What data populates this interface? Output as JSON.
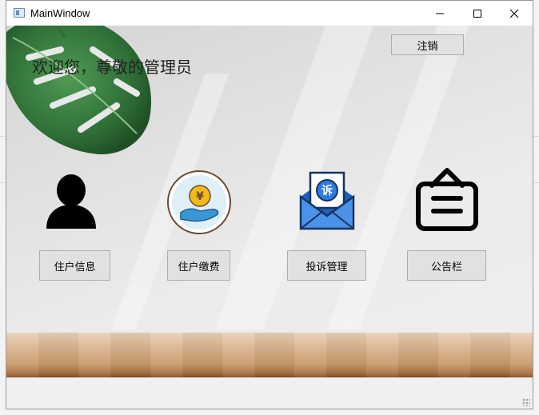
{
  "window": {
    "title": "MainWindow",
    "controls": {
      "minimize": "minimize-icon",
      "maximize": "maximize-icon",
      "close": "close-icon"
    }
  },
  "header": {
    "welcome_text": "欢迎您，尊敬的管理员",
    "logout_label": "注销"
  },
  "modules": [
    {
      "id": "resident",
      "icon": "person-icon",
      "label": "住户信息"
    },
    {
      "id": "payment",
      "icon": "payment-icon",
      "label": "住户缴费"
    },
    {
      "id": "complaint",
      "icon": "complaint-mail-icon",
      "label": "投诉管理",
      "icon_glyph": "诉"
    },
    {
      "id": "notice",
      "icon": "notice-board-icon",
      "label": "公告栏"
    }
  ],
  "colors": {
    "button_bg": "#e1e1e1",
    "mail_blue": "#2f7be0",
    "coin_yellow": "#f5b91a"
  }
}
